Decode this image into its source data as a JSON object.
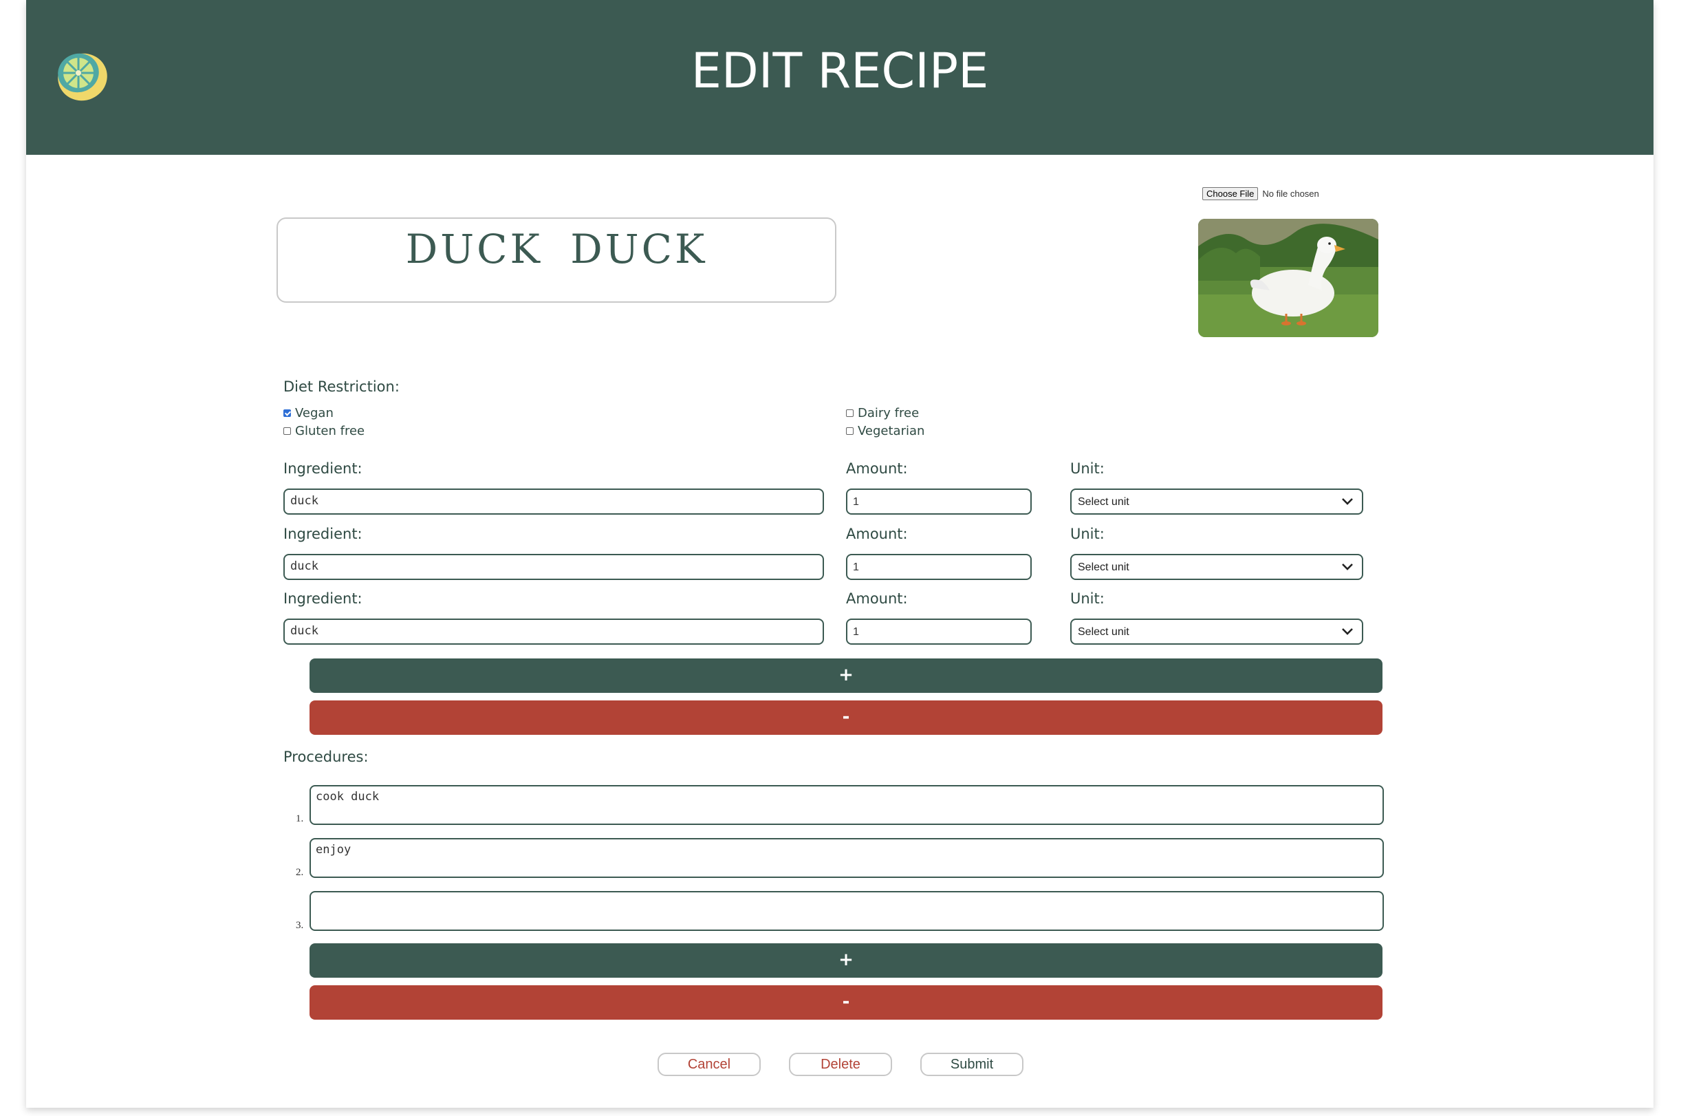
{
  "header": {
    "title": "EDIT RECIPE",
    "logo_icon": "lemon-slice-icon",
    "background": "#3c5a52"
  },
  "image_upload": {
    "button_label": "Choose File",
    "status": "No file chosen",
    "photo_description_icon": "duck-photo"
  },
  "recipe": {
    "name": "DUCK DUCK"
  },
  "diet": {
    "label": "Diet Restriction:",
    "options": [
      {
        "label": "Vegan",
        "checked": true
      },
      {
        "label": "Dairy free",
        "checked": false
      },
      {
        "label": "Gluten free",
        "checked": false
      },
      {
        "label": "Vegetarian",
        "checked": false
      }
    ]
  },
  "ingredients": {
    "ingredient_label": "Ingredient:",
    "amount_label": "Amount:",
    "unit_label": "Unit:",
    "rows": [
      {
        "name": "duck",
        "amount": "1",
        "unit": "Select unit"
      },
      {
        "name": "duck",
        "amount": "1",
        "unit": "Select unit"
      },
      {
        "name": "duck",
        "amount": "1",
        "unit": "Select unit"
      }
    ],
    "add_label": "+",
    "remove_label": "-"
  },
  "procedures": {
    "label": "Procedures:",
    "steps": [
      {
        "number": "1.",
        "text": "cook duck"
      },
      {
        "number": "2.",
        "text": "enjoy"
      },
      {
        "number": "3.",
        "text": ""
      }
    ],
    "add_label": "+",
    "remove_label": "-"
  },
  "actions": {
    "cancel": "Cancel",
    "delete": "Delete",
    "submit": "Submit"
  },
  "colors": {
    "primary": "#3c5a52",
    "danger": "#b24336"
  }
}
